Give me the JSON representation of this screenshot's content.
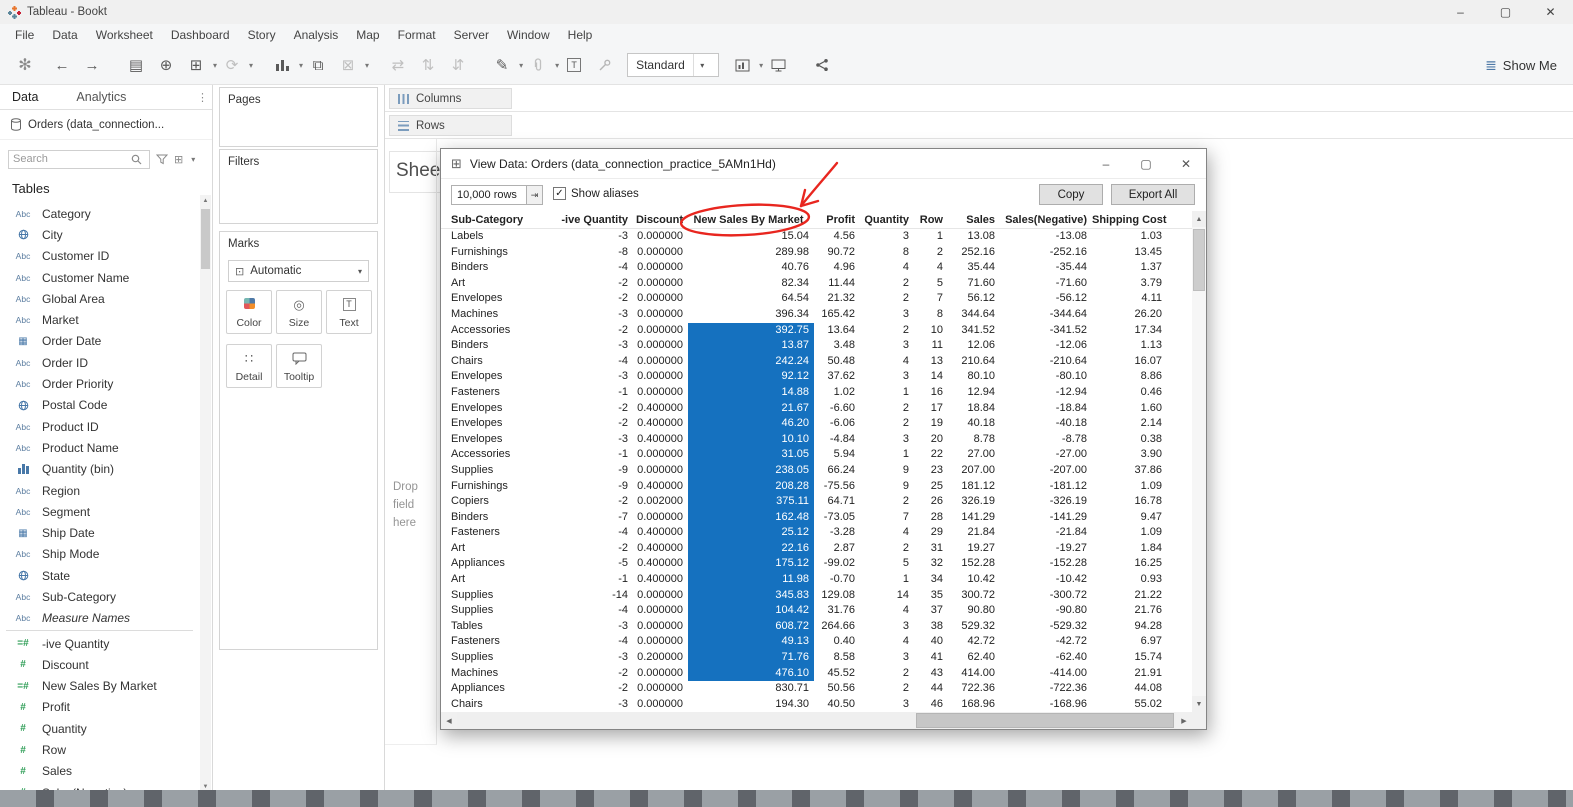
{
  "window": {
    "title": "Tableau - Bookt"
  },
  "menu": [
    "File",
    "Data",
    "Worksheet",
    "Dashboard",
    "Story",
    "Analysis",
    "Map",
    "Format",
    "Server",
    "Window",
    "Help"
  ],
  "toolbar": {
    "view_mode": "Standard",
    "show_me_label": "Show Me"
  },
  "icons": {
    "minimize": "–",
    "maximize": "▢",
    "close": "✕",
    "caret": "▾",
    "sparkle": "✻",
    "back": "←",
    "forward": "→",
    "save": "▤",
    "add_data": "⊕",
    "new_sheet": "⊞",
    "refresh": "⟳",
    "duplicate": "⧉",
    "clear": "⊠",
    "swap": "⇄",
    "sort_asc": "⇅",
    "sort_desc": "⇵",
    "highlighter": "✎",
    "mark_label_T": "T",
    "show_me": "≣",
    "grid": "⊞",
    "spin_arrow": "⇥",
    "check": "✓",
    "up": "▲",
    "down": "▼",
    "left": "◀",
    "right": "▶",
    "panel_more": "⋮",
    "abc": "Abc",
    "num": "#",
    "calc": "=#",
    "calendar": "▦",
    "auto_mark": "⊡",
    "detail": "∷",
    "size": "◎"
  },
  "sidebar": {
    "tab_data": "Data",
    "tab_analytics": "Analytics",
    "data_source": "Orders (data_connection...",
    "search_placeholder": "Search",
    "tables_header": "Tables",
    "measures_start_index": 20,
    "fields": [
      {
        "label": "Category",
        "icon": "abc"
      },
      {
        "label": "City",
        "icon": "globe"
      },
      {
        "label": "Customer ID",
        "icon": "abc"
      },
      {
        "label": "Customer Name",
        "icon": "abc"
      },
      {
        "label": "Global Area",
        "icon": "abc"
      },
      {
        "label": "Market",
        "icon": "abc"
      },
      {
        "label": "Order Date",
        "icon": "calendar"
      },
      {
        "label": "Order ID",
        "icon": "abc"
      },
      {
        "label": "Order Priority",
        "icon": "abc"
      },
      {
        "label": "Postal Code",
        "icon": "globe"
      },
      {
        "label": "Product ID",
        "icon": "abc"
      },
      {
        "label": "Product Name",
        "icon": "abc"
      },
      {
        "label": "Quantity (bin)",
        "icon": "bin"
      },
      {
        "label": "Region",
        "icon": "abc"
      },
      {
        "label": "Segment",
        "icon": "abc"
      },
      {
        "label": "Ship Date",
        "icon": "calendar"
      },
      {
        "label": "Ship Mode",
        "icon": "abc"
      },
      {
        "label": "State",
        "icon": "globe"
      },
      {
        "label": "Sub-Category",
        "icon": "abc"
      },
      {
        "label": "Measure Names",
        "icon": "abc",
        "italic": true
      },
      {
        "label": "-ive Quantity",
        "icon": "calc"
      },
      {
        "label": "Discount",
        "icon": "num"
      },
      {
        "label": "New Sales By Market",
        "icon": "calc"
      },
      {
        "label": "Profit",
        "icon": "num"
      },
      {
        "label": "Quantity",
        "icon": "num"
      },
      {
        "label": "Row",
        "icon": "num"
      },
      {
        "label": "Sales",
        "icon": "num"
      },
      {
        "label": "Sales(Negative)",
        "icon": "num"
      }
    ]
  },
  "cards": {
    "pages_label": "Pages",
    "filters_label": "Filters",
    "marks_label": "Marks",
    "mark_type": "Automatic",
    "color_label": "Color",
    "size_label": "Size",
    "text_label": "Text",
    "detail_label": "Detail",
    "tooltip_label": "Tooltip"
  },
  "shelves": {
    "columns_label": "Columns",
    "rows_label": "Rows"
  },
  "sheet": {
    "title_visible": "Shee",
    "drop_hint_lines": [
      "Drop",
      "field",
      "here"
    ]
  },
  "dialog": {
    "title": "View Data:  Orders (data_connection_practice_5AMn1Hd)",
    "rows_field_value": "10,000 rows",
    "show_aliases_label": "Show aliases",
    "copy_label": "Copy",
    "export_all_label": "Export All",
    "highlight_color": "#1571bf",
    "columns": [
      "Sub-Category",
      "-ive Quantity",
      "Discount",
      "New Sales By Market",
      "Profit",
      "Quantity",
      "Row",
      "Sales",
      "Sales(Negative)",
      "Shipping Cost"
    ],
    "rows": [
      [
        "Labels",
        "-3",
        "0.000000",
        "15.04",
        "4.56",
        "3",
        "1",
        "13.08",
        "-13.08",
        "1.03"
      ],
      [
        "Furnishings",
        "-8",
        "0.000000",
        "289.98",
        "90.72",
        "8",
        "2",
        "252.16",
        "-252.16",
        "13.45"
      ],
      [
        "Binders",
        "-4",
        "0.000000",
        "40.76",
        "4.96",
        "4",
        "4",
        "35.44",
        "-35.44",
        "1.37"
      ],
      [
        "Art",
        "-2",
        "0.000000",
        "82.34",
        "11.44",
        "2",
        "5",
        "71.60",
        "-71.60",
        "3.79"
      ],
      [
        "Envelopes",
        "-2",
        "0.000000",
        "64.54",
        "21.32",
        "2",
        "7",
        "56.12",
        "-56.12",
        "4.11"
      ],
      [
        "Machines",
        "-3",
        "0.000000",
        "396.34",
        "165.42",
        "3",
        "8",
        "344.64",
        "-344.64",
        "26.20"
      ],
      [
        "Accessories",
        "-2",
        "0.000000",
        "392.75",
        "13.64",
        "2",
        "10",
        "341.52",
        "-341.52",
        "17.34"
      ],
      [
        "Binders",
        "-3",
        "0.000000",
        "13.87",
        "3.48",
        "3",
        "11",
        "12.06",
        "-12.06",
        "1.13"
      ],
      [
        "Chairs",
        "-4",
        "0.000000",
        "242.24",
        "50.48",
        "4",
        "13",
        "210.64",
        "-210.64",
        "16.07"
      ],
      [
        "Envelopes",
        "-3",
        "0.000000",
        "92.12",
        "37.62",
        "3",
        "14",
        "80.10",
        "-80.10",
        "8.86"
      ],
      [
        "Fasteners",
        "-1",
        "0.000000",
        "14.88",
        "1.02",
        "1",
        "16",
        "12.94",
        "-12.94",
        "0.46"
      ],
      [
        "Envelopes",
        "-2",
        "0.400000",
        "21.67",
        "-6.60",
        "2",
        "17",
        "18.84",
        "-18.84",
        "1.60"
      ],
      [
        "Envelopes",
        "-2",
        "0.400000",
        "46.20",
        "-6.06",
        "2",
        "19",
        "40.18",
        "-40.18",
        "2.14"
      ],
      [
        "Envelopes",
        "-3",
        "0.400000",
        "10.10",
        "-4.84",
        "3",
        "20",
        "8.78",
        "-8.78",
        "0.38"
      ],
      [
        "Accessories",
        "-1",
        "0.000000",
        "31.05",
        "5.94",
        "1",
        "22",
        "27.00",
        "-27.00",
        "3.90"
      ],
      [
        "Supplies",
        "-9",
        "0.000000",
        "238.05",
        "66.24",
        "9",
        "23",
        "207.00",
        "-207.00",
        "37.86"
      ],
      [
        "Furnishings",
        "-9",
        "0.400000",
        "208.28",
        "-75.56",
        "9",
        "25",
        "181.12",
        "-181.12",
        "1.09"
      ],
      [
        "Copiers",
        "-2",
        "0.002000",
        "375.11",
        "64.71",
        "2",
        "26",
        "326.19",
        "-326.19",
        "16.78"
      ],
      [
        "Binders",
        "-7",
        "0.000000",
        "162.48",
        "-73.05",
        "7",
        "28",
        "141.29",
        "-141.29",
        "9.47"
      ],
      [
        "Fasteners",
        "-4",
        "0.400000",
        "25.12",
        "-3.28",
        "4",
        "29",
        "21.84",
        "-21.84",
        "1.09"
      ],
      [
        "Art",
        "-2",
        "0.400000",
        "22.16",
        "2.87",
        "2",
        "31",
        "19.27",
        "-19.27",
        "1.84"
      ],
      [
        "Appliances",
        "-5",
        "0.400000",
        "175.12",
        "-99.02",
        "5",
        "32",
        "152.28",
        "-152.28",
        "16.25"
      ],
      [
        "Art",
        "-1",
        "0.400000",
        "11.98",
        "-0.70",
        "1",
        "34",
        "10.42",
        "-10.42",
        "0.93"
      ],
      [
        "Supplies",
        "-14",
        "0.000000",
        "345.83",
        "129.08",
        "14",
        "35",
        "300.72",
        "-300.72",
        "21.22"
      ],
      [
        "Supplies",
        "-4",
        "0.000000",
        "104.42",
        "31.76",
        "4",
        "37",
        "90.80",
        "-90.80",
        "21.76"
      ],
      [
        "Tables",
        "-3",
        "0.000000",
        "608.72",
        "264.66",
        "3",
        "38",
        "529.32",
        "-529.32",
        "94.28"
      ],
      [
        "Fasteners",
        "-4",
        "0.000000",
        "49.13",
        "0.40",
        "4",
        "40",
        "42.72",
        "-42.72",
        "6.97"
      ],
      [
        "Supplies",
        "-3",
        "0.200000",
        "71.76",
        "8.58",
        "3",
        "41",
        "62.40",
        "-62.40",
        "15.74"
      ],
      [
        "Machines",
        "-2",
        "0.000000",
        "476.10",
        "45.52",
        "2",
        "43",
        "414.00",
        "-414.00",
        "21.91"
      ],
      [
        "Appliances",
        "-2",
        "0.000000",
        "830.71",
        "50.56",
        "2",
        "44",
        "722.36",
        "-722.36",
        "44.08"
      ],
      [
        "Chairs",
        "-3",
        "0.000000",
        "194.30",
        "40.50",
        "3",
        "46",
        "168.96",
        "-168.96",
        "55.02"
      ]
    ],
    "highlighted_rows": [
      6,
      7,
      8,
      9,
      10,
      11,
      12,
      13,
      14,
      15,
      16,
      17,
      18,
      19,
      20,
      21,
      22,
      23,
      24,
      25,
      26,
      27,
      28
    ]
  },
  "annotation": {
    "color": "#e8261f",
    "target": "New Sales By Market"
  }
}
